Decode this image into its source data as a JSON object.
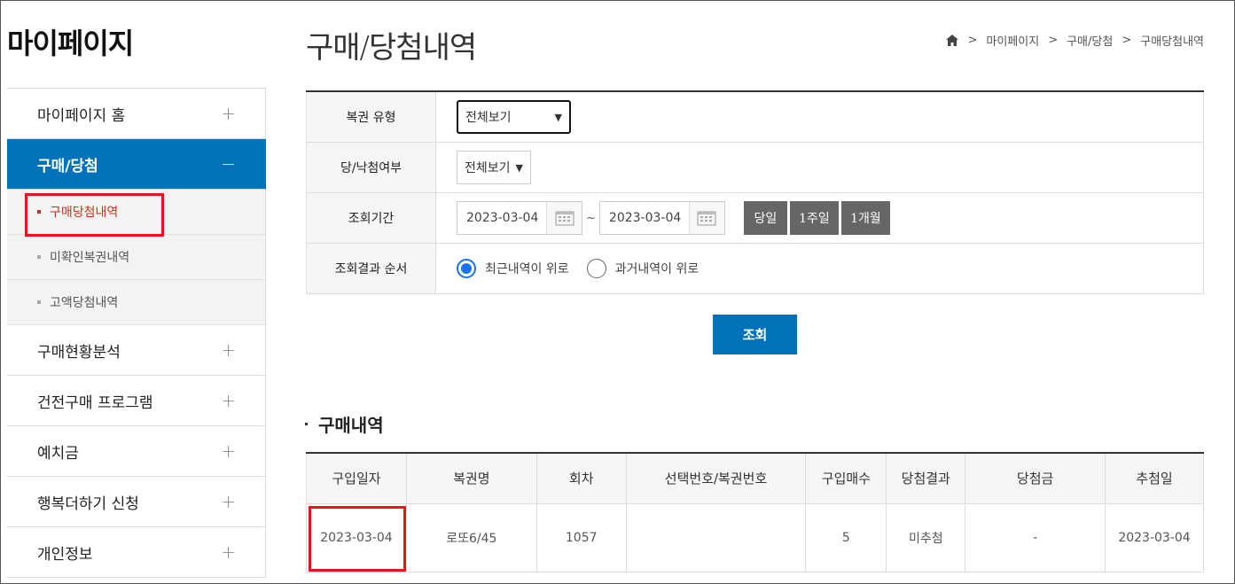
{
  "sidebar": {
    "title": "마이페이지",
    "items": [
      {
        "label": "마이페이지 홈",
        "toggle": "+"
      },
      {
        "label": "구매/당첨",
        "toggle": "−"
      },
      {
        "label": "구매현황분석",
        "toggle": "+"
      },
      {
        "label": "건전구매 프로그램",
        "toggle": "+"
      },
      {
        "label": "예치금",
        "toggle": "+"
      },
      {
        "label": "행복더하기 신청",
        "toggle": "+"
      },
      {
        "label": "개인정보",
        "toggle": "+"
      }
    ],
    "subitems": [
      "구매당첨내역",
      "미확인복권내역",
      "고액당첨내역"
    ]
  },
  "header": {
    "title": "구매/당첨내역",
    "breadcrumb": [
      "마이페이지",
      "구매/당첨",
      "구매당첨내역"
    ],
    "separator": ">"
  },
  "search": {
    "lottery_type_label": "복권 유형",
    "lottery_type_value": "전체보기",
    "win_status_label": "당/낙첨여부",
    "win_status_value": "전체보기",
    "period_label": "조회기간",
    "date_from": "2023-03-04",
    "date_to": "2023-03-04",
    "tilde": "~",
    "period_buttons": [
      "당일",
      "1주일",
      "1개월"
    ],
    "order_label": "조회결과 순서",
    "order_options": [
      "최근내역이 위로",
      "과거내역이 위로"
    ],
    "order_selected": 0,
    "submit_label": "조회"
  },
  "results": {
    "title": "구매내역",
    "columns": [
      "구입일자",
      "복권명",
      "회차",
      "선택번호/복권번호",
      "구입매수",
      "당첨결과",
      "당첨금",
      "추첨일"
    ],
    "rows": [
      [
        "2023-03-04",
        "로또6/45",
        "1057",
        "",
        "5",
        "미추첨",
        "-",
        "2023-03-04"
      ]
    ]
  },
  "colors": {
    "accent": "#0072bc",
    "highlight": "#e8141c",
    "current_sub": "#c8331c",
    "period_button": "#666666"
  }
}
